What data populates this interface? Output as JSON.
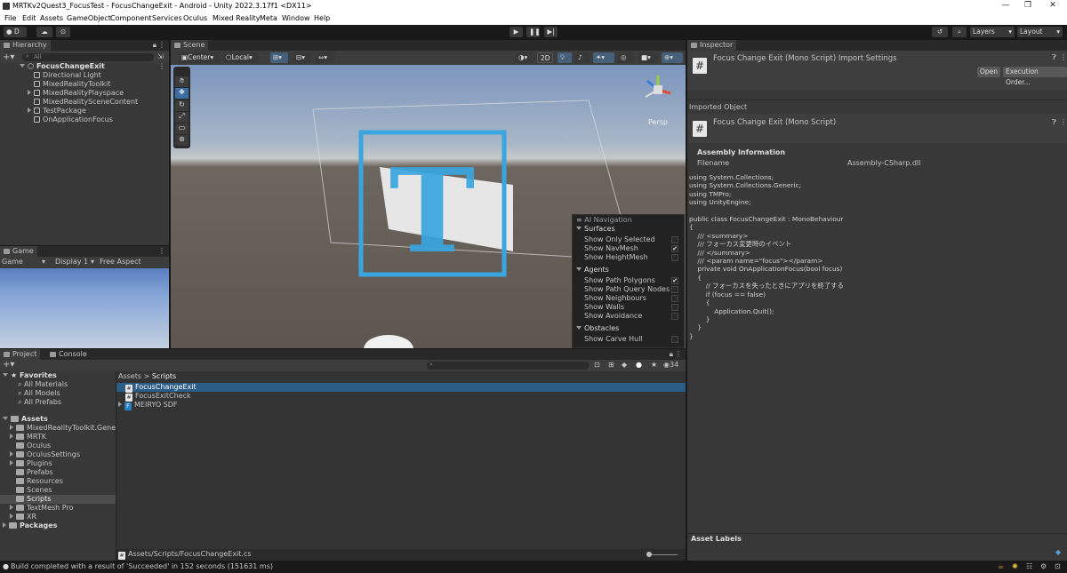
{
  "window": {
    "title": "MRTKv2Quest3_FocusTest - FocusChangeExit - Android - Unity 2022.3.17f1 <DX11>",
    "controls": [
      "—",
      "❐",
      "✕"
    ]
  },
  "menu": [
    "File",
    "Edit",
    "Assets",
    "GameObject",
    "Component",
    "Services",
    "Oculus",
    "Mixed Reality",
    "Meta",
    "Window",
    "Help"
  ],
  "toolbar": {
    "account": "D",
    "layers": "Layers",
    "layout": "Layout"
  },
  "hierarchy": {
    "tab": "Hierarchy",
    "search_placeholder": "All",
    "root": "FocusChangeExit",
    "items": [
      "Directional Light",
      "MixedRealityToolkit",
      "MixedRealityPlayspace",
      "MixedRealitySceneContent",
      "TestPackage",
      "OnApplicationFocus"
    ]
  },
  "scene": {
    "tab": "Scene",
    "pivot": "Center",
    "space": "Local",
    "mode_2d": "2D",
    "persp": "Persp"
  },
  "ai_navigation": {
    "title": "AI Navigation",
    "surfaces": {
      "header": "Surfaces",
      "items": [
        {
          "label": "Show Only Selected",
          "checked": ""
        },
        {
          "label": "Show NavMesh",
          "checked": "✔"
        },
        {
          "label": "Show HeightMesh",
          "checked": ""
        }
      ]
    },
    "agents": {
      "header": "Agents",
      "items": [
        {
          "label": "Show Path Polygons",
          "checked": "✔"
        },
        {
          "label": "Show Path Query Nodes",
          "checked": ""
        },
        {
          "label": "Show Neighbours",
          "checked": ""
        },
        {
          "label": "Show Walls",
          "checked": ""
        },
        {
          "label": "Show Avoidance",
          "checked": ""
        }
      ]
    },
    "obstacles": {
      "header": "Obstacles",
      "items": [
        {
          "label": "Show Carve Hull",
          "checked": ""
        }
      ]
    }
  },
  "game": {
    "tab": "Game",
    "mode": "Game",
    "display": "Display 1",
    "aspect": "Free Aspect"
  },
  "project": {
    "tab_project": "Project",
    "tab_console": "Console",
    "hidden_count": "34",
    "favorites": {
      "header": "Favorites",
      "items": [
        "All Materials",
        "All Models",
        "All Prefabs"
      ]
    },
    "assets": {
      "header": "Assets",
      "items": [
        "MixedRealityToolkit.Generat",
        "MRTK",
        "Oculus",
        "OculusSettings",
        "Plugins",
        "Prefabs",
        "Resources",
        "Scenes",
        "Scripts",
        "TextMesh Pro",
        "XR"
      ]
    },
    "packages": "Packages",
    "breadcrumb": [
      "Assets",
      "Scripts"
    ],
    "files": [
      "FocusChangeExit",
      "FocusExitCheck",
      "MEIRYO SDF"
    ],
    "path": "Assets/Scripts/FocusChangeExit.cs"
  },
  "inspector": {
    "tab": "Inspector",
    "header_title": "Focus Change Exit (Mono Script) Import Settings",
    "open_button": "Open",
    "exec_order_button": "Execution Order...",
    "imported_object": "Imported Object",
    "script_title": "Focus Change Exit (Mono Script)",
    "assembly_info": "Assembly Information",
    "filename_label": "Filename",
    "filename_value": "Assembly-CSharp.dll",
    "code": "using System.Collections;\nusing System.Collections.Generic;\nusing TMPro;\nusing UnityEngine;\n\npublic class FocusChangeExit : MonoBehaviour\n{\n    /// <summary>\n    /// フォーカス変更時のイベント\n    /// </summary>\n    /// <param name=\"focus\"></param>\n    private void OnApplicationFocus(bool focus)\n    {\n        // フォーカスを失ったときにアプリを終了する\n        if (focus == false)\n        {\n            Application.Quit();\n        }\n    }\n}",
    "asset_labels": "Asset Labels"
  },
  "status": {
    "message": "Build completed with a result of 'Succeeded' in 152 seconds (151631 ms)"
  },
  "colors": {
    "accent": "#2c5d87",
    "text_icon_blue": "#3aa6e0"
  }
}
